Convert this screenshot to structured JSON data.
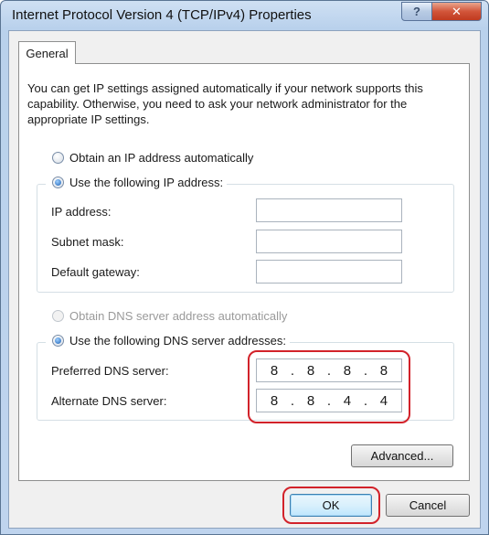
{
  "window": {
    "title": "Internet Protocol Version 4 (TCP/IPv4) Properties",
    "help_glyph": "?",
    "close_glyph": "✕"
  },
  "tabs": {
    "general": "General"
  },
  "description": "You can get IP settings assigned automatically if your network supports this capability. Otherwise, you need to ask your network administrator for the appropriate IP settings.",
  "ip": {
    "obtain_auto_label": "Obtain an IP address automatically",
    "use_following_label": "Use the following IP address:",
    "address_label": "IP address:",
    "address_value": "",
    "subnet_label": "Subnet mask:",
    "subnet_value": "",
    "gateway_label": "Default gateway:",
    "gateway_value": ""
  },
  "dns": {
    "obtain_auto_label": "Obtain DNS server address automatically",
    "use_following_label": "Use the following DNS server addresses:",
    "preferred_label": "Preferred DNS server:",
    "preferred_octets": [
      "8",
      "8",
      "8",
      "8"
    ],
    "alternate_label": "Alternate DNS server:",
    "alternate_octets": [
      "8",
      "8",
      "4",
      "4"
    ]
  },
  "buttons": {
    "advanced": "Advanced...",
    "ok": "OK",
    "cancel": "Cancel"
  },
  "colors": {
    "highlight": "#d2222a",
    "radio_selected": "#1a5fb4"
  }
}
